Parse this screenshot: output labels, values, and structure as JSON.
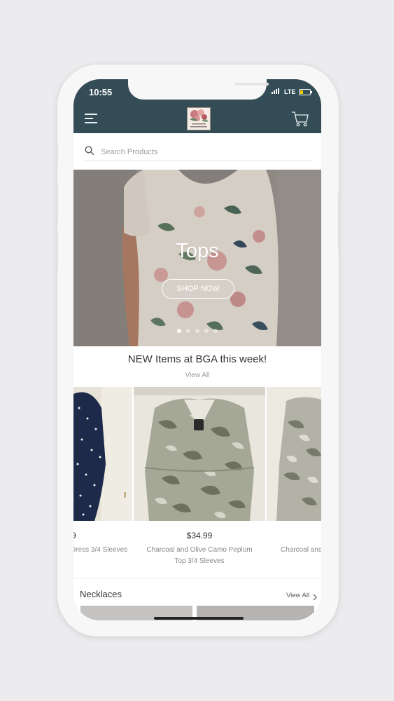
{
  "status_bar": {
    "time": "10:55",
    "network": "LTE"
  },
  "header": {
    "logo_text": "BGA Boutique"
  },
  "search": {
    "placeholder": "Search Products",
    "value": ""
  },
  "hero": {
    "title": "Tops",
    "button_label": "SHOP NOW",
    "slide_count": 5,
    "active_slide": 1
  },
  "new_items": {
    "title": "NEW Items at BGA this week!",
    "view_all_label": "View All",
    "products": [
      {
        "price": "9",
        "name": "Dress 3/4 Sleeves"
      },
      {
        "price": "$34.99",
        "name": "Charcoal and Olive Camo Peplum Top 3/4 Sleeves"
      },
      {
        "price": "",
        "name": "Charcoal and Swe"
      }
    ]
  },
  "necklaces": {
    "title": "Necklaces",
    "view_all_label": "View All"
  },
  "colors": {
    "header_bg": "#334c55",
    "battery": "#f2d400"
  }
}
